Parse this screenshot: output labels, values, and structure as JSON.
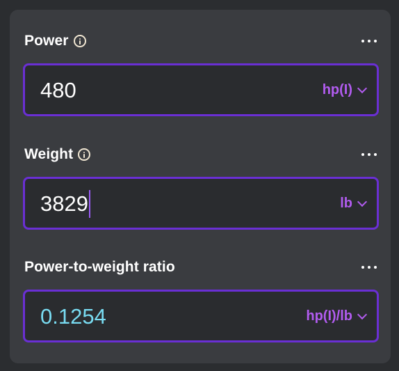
{
  "fields": [
    {
      "label": "Power",
      "has_info": true,
      "value": "480",
      "unit": "hp(I)"
    },
    {
      "label": "Weight",
      "has_info": true,
      "value": "3829",
      "unit": "lb"
    },
    {
      "label": "Power-to-weight ratio",
      "has_info": false,
      "value": "0.1254",
      "unit": "hp(I)/lb"
    }
  ],
  "icons": {
    "info": "info-icon",
    "more": "more-options-icon",
    "chevron": "chevron-down-icon"
  },
  "colors": {
    "accent_border": "#6a2fd4",
    "unit_text": "#b25cf0",
    "result_text": "#79dcf2",
    "panel_bg": "#3a3c40",
    "input_bg": "#2a2c2f"
  }
}
